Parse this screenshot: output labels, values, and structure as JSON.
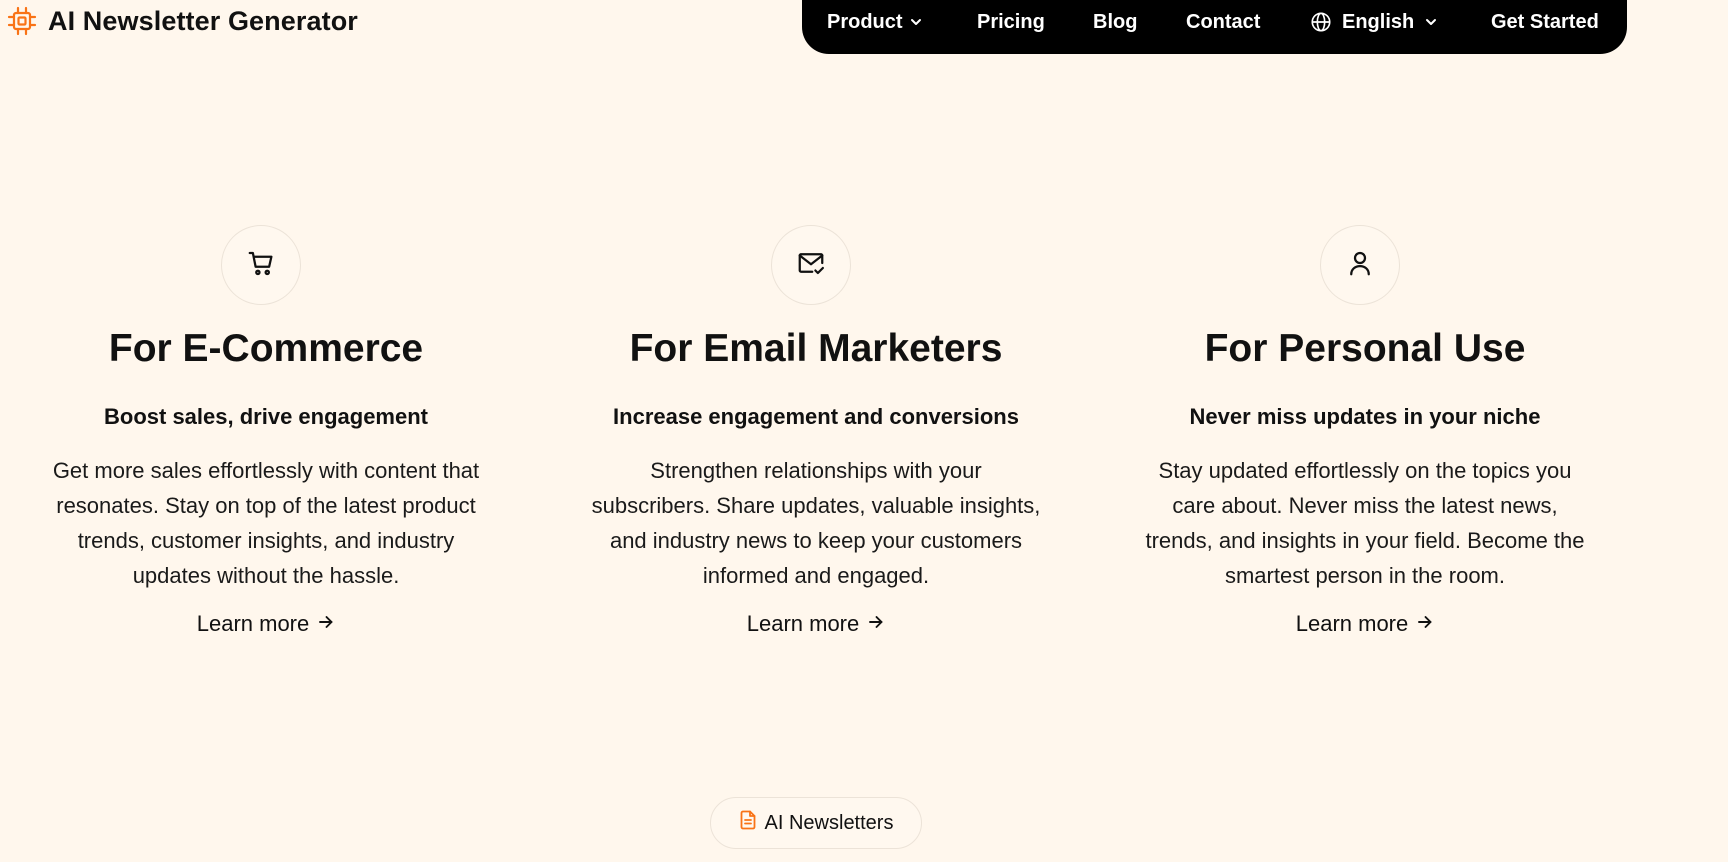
{
  "brand": {
    "name": "AI Newsletter Generator",
    "logo_icon": "chip-icon",
    "accent_color": "#f97316"
  },
  "nav": {
    "items": [
      {
        "label": "Product",
        "has_dropdown": true
      },
      {
        "label": "Pricing"
      },
      {
        "label": "Blog"
      },
      {
        "label": "Contact"
      }
    ],
    "language": {
      "label": "English",
      "icon": "globe-icon"
    },
    "cta": "Get Started",
    "background": "#000000"
  },
  "cards": [
    {
      "icon": "shopping-cart-icon",
      "title": "For E-Commerce",
      "subtitle": "Boost sales, drive engagement",
      "body": "Get more sales effortlessly with content that resonates. Stay on top of the latest product trends, customer insights, and industry updates without the hassle.",
      "link": "Learn more"
    },
    {
      "icon": "mail-check-icon",
      "title": "For Email Marketers",
      "subtitle": "Increase engagement and conversions",
      "body": "Strengthen relationships with your subscribers. Share updates, valuable insights, and industry news to keep your customers informed and engaged.",
      "link": "Learn more"
    },
    {
      "icon": "user-icon",
      "title": "For Personal Use",
      "subtitle": "Never miss updates in your niche",
      "body": "Stay updated effortlessly on the topics you care about. Never miss the latest news, trends, and insights in your field. Become the smartest person in the room.",
      "link": "Learn more"
    }
  ],
  "badge": {
    "label": "AI Newsletters",
    "icon": "document-icon"
  },
  "colors": {
    "page_background": "#fff7ed",
    "text": "#111111"
  }
}
